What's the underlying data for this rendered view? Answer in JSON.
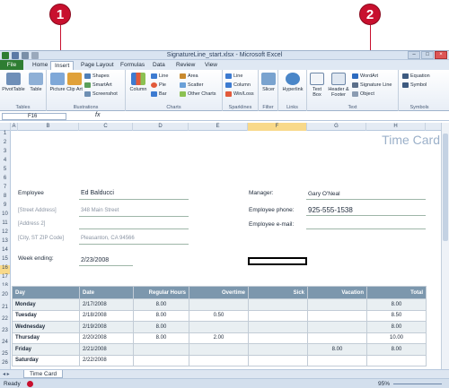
{
  "callouts": [
    "1",
    "2"
  ],
  "window": {
    "title": "SignatureLine_start.xlsx - Microsoft Excel",
    "controls": [
      "–",
      "□",
      "×"
    ]
  },
  "tabs": [
    "File",
    "Home",
    "Insert",
    "Page Layout",
    "Formulas",
    "Data",
    "Review",
    "View"
  ],
  "ribbon": {
    "tables": {
      "label": "Tables",
      "pivot": "PivotTable",
      "table": "Table"
    },
    "illustrations": {
      "label": "Illustrations",
      "picture": "Picture",
      "clipart": "Clip Art",
      "shapes": "Shapes",
      "smartart": "SmartArt",
      "screenshot": "Screenshot"
    },
    "charts": {
      "label": "Charts",
      "column": "Column",
      "line": "Line",
      "pie": "Pie",
      "bar": "Bar",
      "area": "Area",
      "scatter": "Scatter",
      "other": "Other Charts"
    },
    "sparklines": {
      "label": "Sparklines",
      "line": "Line",
      "column": "Column",
      "winloss": "Win/Loss"
    },
    "filter": {
      "label": "Filter",
      "slicer": "Slicer"
    },
    "links": {
      "label": "Links",
      "hyperlink": "Hyperlink"
    },
    "text": {
      "label": "Text",
      "textbox": "Text Box",
      "header": "Header & Footer",
      "wordart": "WordArt",
      "signature": "Signature Line",
      "object": "Object"
    },
    "symbols": {
      "label": "Symbols",
      "equation": "Equation",
      "symbol": "Symbol"
    }
  },
  "formula_bar": {
    "name_box": "F16",
    "fx": "fx"
  },
  "columns": [
    "A",
    "B",
    "C",
    "D",
    "E",
    "F",
    "G",
    "H"
  ],
  "rows": [
    "1",
    "2",
    "3",
    "4",
    "5",
    "6",
    "7",
    "8",
    "9",
    "10",
    "11",
    "12",
    "13",
    "14",
    "15",
    "16",
    "17",
    "18",
    "19",
    "20",
    "21",
    "22",
    "23",
    "24",
    "25",
    "26"
  ],
  "sheet": {
    "heading": "Time Card",
    "employee_label": "Employee",
    "employee_name": "Ed Balducci",
    "street_label": "[Street Address]",
    "street_value": "348 Main Street",
    "address2_label": "[Address 2]",
    "city_label": "[City, ST  ZIP Code]",
    "city_value": "Pleasanton, CA 94566",
    "week_label": "Week ending:",
    "week_value": "2/23/2008",
    "manager_label": "Manager:",
    "manager_value": "Gary O'Neal",
    "phone_label": "Employee phone:",
    "phone_value": "925-555-1538",
    "email_label": "Employee e-mail:"
  },
  "table": {
    "headers": [
      "Day",
      "Date",
      "Regular Hours",
      "Overtime",
      "Sick",
      "Vacation",
      "Total"
    ],
    "rows": [
      [
        "Monday",
        "2/17/2008",
        "8.00",
        "",
        "",
        "",
        "8.00"
      ],
      [
        "Tuesday",
        "2/18/2008",
        "8.00",
        "0.50",
        "",
        "",
        "8.50"
      ],
      [
        "Wednesday",
        "2/19/2008",
        "8.00",
        "",
        "",
        "",
        "8.00"
      ],
      [
        "Thursday",
        "2/20/2008",
        "8.00",
        "2.00",
        "",
        "",
        "10.00"
      ],
      [
        "Friday",
        "2/21/2008",
        "",
        "",
        "",
        "8.00",
        "8.00"
      ],
      [
        "Saturday",
        "2/22/2008",
        "",
        "",
        "",
        "",
        ""
      ]
    ]
  },
  "sheet_tab": "Time Card",
  "status": {
    "ready": "Ready",
    "zoom": "95%"
  },
  "colors": {
    "accent": "#c8102e",
    "file_tab": "#2e7d32",
    "table_header": "#7c97ad"
  }
}
